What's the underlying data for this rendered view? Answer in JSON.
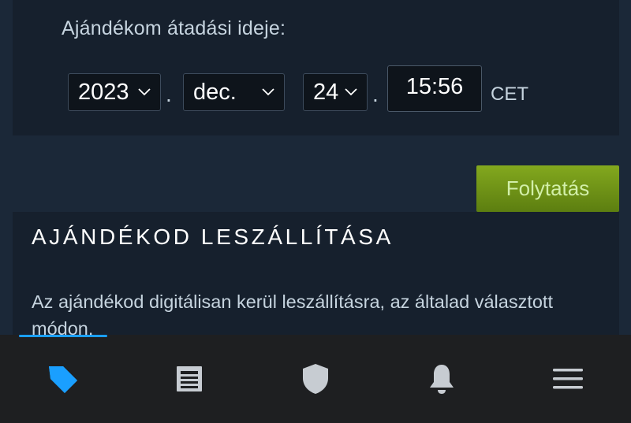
{
  "gift_schedule": {
    "label": "Ajándékom átadási ideje:",
    "year": "2023",
    "month": "dec.",
    "day": "24",
    "separator": ".",
    "time": "15:56",
    "timezone": "CET"
  },
  "actions": {
    "continue_label": "Folytatás",
    "continue_color": "#6f9412"
  },
  "delivery": {
    "title": "AJÁNDÉKOD LESZÁLLÍTÁSA",
    "description": "Az ajándékod digitálisan kerül leszállításra, az általad választott módon."
  },
  "bottom_nav": {
    "active_color": "#1a9fff",
    "items": [
      {
        "icon": "tag-icon",
        "active": true
      },
      {
        "icon": "news-icon",
        "active": false
      },
      {
        "icon": "shield-icon",
        "active": false
      },
      {
        "icon": "bell-icon",
        "active": false
      },
      {
        "icon": "menu-icon",
        "active": false
      }
    ]
  }
}
